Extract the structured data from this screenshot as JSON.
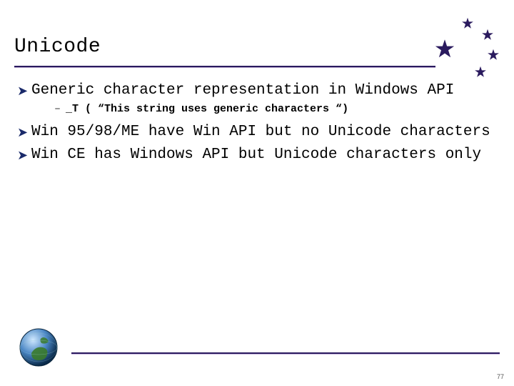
{
  "title": "Unicode",
  "bullets": [
    {
      "text": "Generic character representation in Windows API",
      "sub": [
        "_T ( “This string uses generic characters “)"
      ]
    },
    {
      "text": "Win 95/98/ME have Win API but no Unicode characters",
      "sub": []
    },
    {
      "text": "Win CE has Windows API but Unicode characters only",
      "sub": []
    }
  ],
  "page_number": "77",
  "colors": {
    "accent": "#2a1a5e"
  },
  "icons": {
    "bullet_glyph": "➤",
    "dash_glyph": "–"
  }
}
